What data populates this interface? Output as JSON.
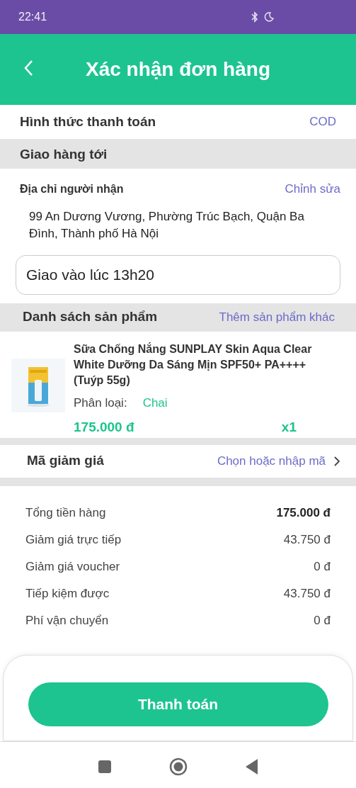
{
  "status_bar": {
    "time": "22:41"
  },
  "header": {
    "title": "Xác nhận đơn hàng"
  },
  "payment": {
    "label": "Hình thức thanh toán",
    "value": "COD"
  },
  "shipping": {
    "heading": "Giao hàng tới",
    "address_label": "Địa chỉ người nhận",
    "edit_link": "Chỉnh sửa",
    "address": "99 An Dương Vương, Phường Trúc Bạch, Quận Ba Đình, Thành phố Hà Nội"
  },
  "note": {
    "value": "Giao vào lúc 13h20"
  },
  "products": {
    "heading": "Danh sách sản phẩm",
    "add_link": "Thêm sản phẩm khác",
    "items": [
      {
        "name": "Sữa Chống Nắng SUNPLAY Skin Aqua Clear White Dưỡng Da Sáng Mịn SPF50+ PA++++ (Tuýp 55g)",
        "variant_label": "Phân loại:",
        "variant": "Chai",
        "price": "175.000 đ",
        "quantity": "x1"
      }
    ]
  },
  "discount": {
    "label": "Mã giảm giá",
    "action": "Chọn hoặc nhập mã"
  },
  "summary": [
    {
      "label": "Tổng tiền hàng",
      "value": "175.000 đ",
      "emphasis": true
    },
    {
      "label": "Giảm giá trực tiếp",
      "value": "43.750 đ",
      "emphasis": false
    },
    {
      "label": "Giảm giá voucher",
      "value": "0 đ",
      "emphasis": false
    },
    {
      "label": "Tiếp kiệm được",
      "value": "43.750 đ",
      "emphasis": false
    },
    {
      "label": "Phí vận chuyển",
      "value": "0 đ",
      "emphasis": false
    }
  ],
  "checkout_button": "Thanh toán"
}
